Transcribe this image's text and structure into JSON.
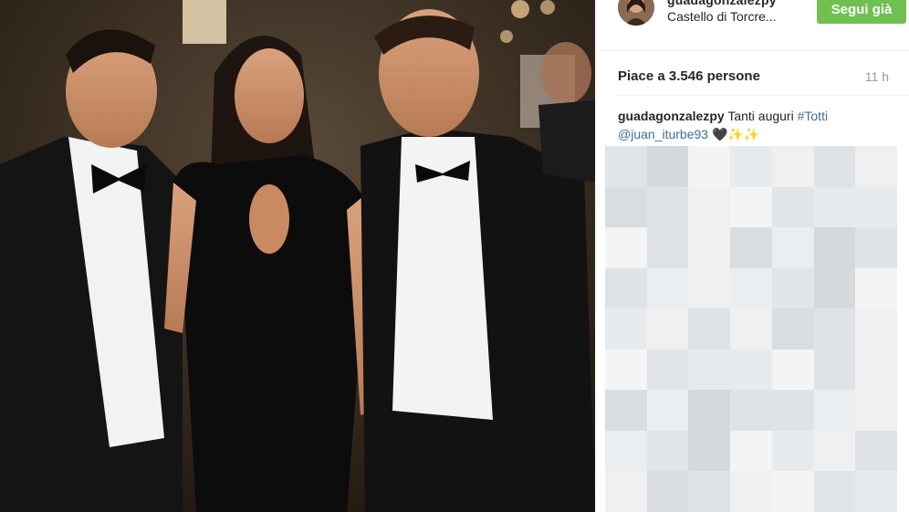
{
  "post": {
    "username": "guadagonzalezpy",
    "location": "Castello di Torcre...",
    "follow_label": "Segui già",
    "likes": "Piace a 3.546 persone",
    "time": "11 h",
    "caption": {
      "username": "guadagonzalezpy",
      "text": "Tanti auguri",
      "hashtag": "#Totti",
      "mention": "@juan_iturbe93",
      "emoji": "🖤✨✨"
    }
  },
  "colors": {
    "follow_button": "#70c050",
    "link": "#3d6e9c",
    "text": "#262626",
    "muted": "#999999"
  },
  "icons": {
    "avatar": "avatar-image"
  }
}
